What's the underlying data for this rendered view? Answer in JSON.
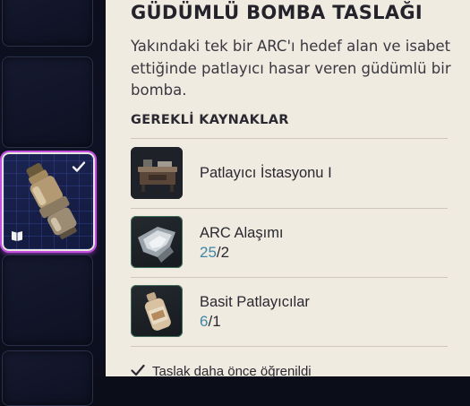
{
  "colors": {
    "panel_bg": "#f0ebe1",
    "inventory_bg": "#0b0d18",
    "selected_glow": "#c44fe0",
    "owned_count": "#3f86a6"
  },
  "inventory": {
    "selected_slot": {
      "item_icon": "guided-bomb-icon",
      "status_icon": "check-icon",
      "badge_icon": "book-icon"
    }
  },
  "blueprint": {
    "title": "GÜDÜMLÜ BOMBA TASLAĞI",
    "description": "Yakındaki tek bir ARC'ı hedef alan ve isabet ettiğinde patlayıcı hasar veren güdümlü bir bomba.",
    "resources_label": "GEREKLİ KAYNAKLAR",
    "resources": [
      {
        "name": "Patlayıcı İstasyonu I",
        "icon": "workbench-icon"
      },
      {
        "name": "ARC Alaşımı",
        "have": "25",
        "sep": "/",
        "need": "2",
        "icon": "alloy-icon"
      },
      {
        "name": "Basit Patlayıcılar",
        "have": "6",
        "sep": "/",
        "need": "1",
        "icon": "bottle-icon"
      }
    ],
    "footer_text": "Taslak daha önce öğrenildi"
  }
}
